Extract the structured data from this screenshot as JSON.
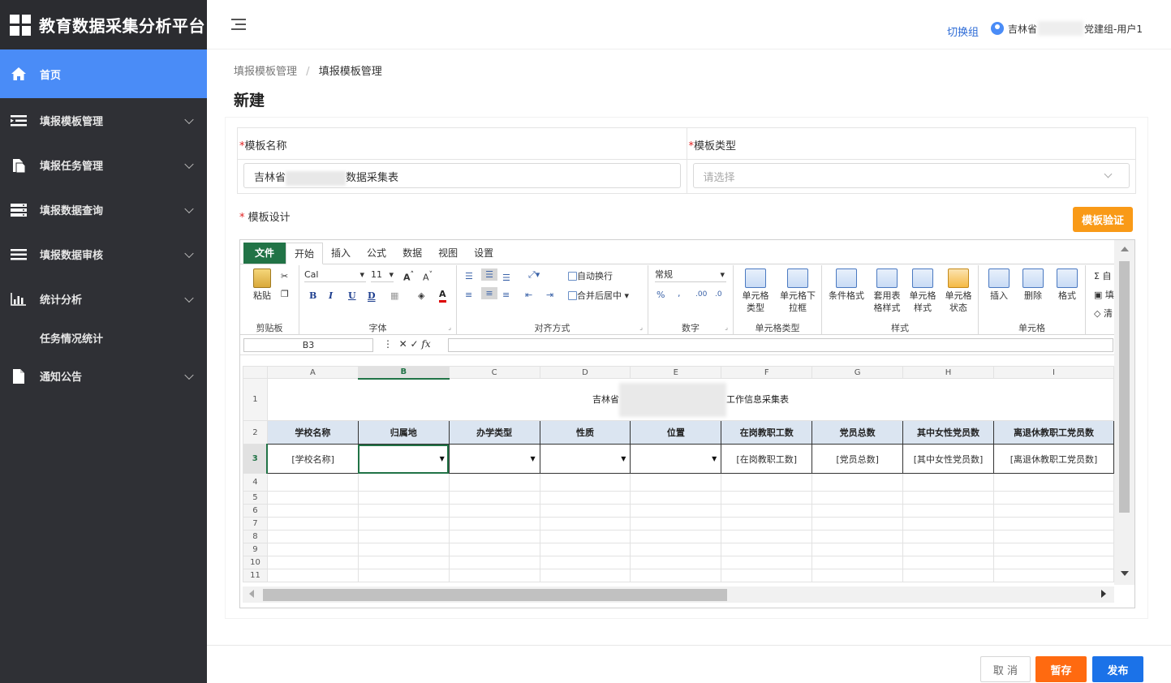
{
  "app": {
    "title": "教育数据采集分析平台"
  },
  "sidebar": {
    "items": [
      {
        "label": "首页",
        "icon": "home-icon",
        "active": true
      },
      {
        "label": "填报模板管理",
        "icon": "list-icon"
      },
      {
        "label": "填报任务管理",
        "icon": "document-icon"
      },
      {
        "label": "填报数据查询",
        "icon": "database-icon"
      },
      {
        "label": "填报数据审核",
        "icon": "stack-icon"
      },
      {
        "label": "统计分析",
        "icon": "bar-chart-icon"
      },
      {
        "label": "任务情况统计",
        "sub": true
      },
      {
        "label": "通知公告",
        "icon": "file-icon"
      }
    ]
  },
  "header": {
    "switch_group": "切换组",
    "user_prefix": "吉林省",
    "user_suffix": "党建组-用户1"
  },
  "breadcrumb": {
    "parent": "填报模板管理",
    "sep": "/",
    "current": "填报模板管理"
  },
  "page_title": "新建",
  "form": {
    "name_label": "模板名称",
    "name_value_prefix": "吉林省",
    "name_value_suffix": "数据采集表",
    "type_label": "模板类型",
    "type_placeholder": "请选择",
    "required_mark": "*",
    "design_label": "模板设计",
    "verify_button": "模板验证"
  },
  "spreadsheet": {
    "tabs": [
      "文件",
      "开始",
      "插入",
      "公式",
      "数据",
      "视图",
      "设置"
    ],
    "active_tab": "开始",
    "ribbon": {
      "clipboard": {
        "group": "剪贴板",
        "paste": "粘贴"
      },
      "font": {
        "group": "字体",
        "font_name": "Cal",
        "font_size": "11"
      },
      "align": {
        "group": "对齐方式",
        "wrap": "自动换行",
        "merge": "合并后居中"
      },
      "number": {
        "group": "数字",
        "format": "常规"
      },
      "celltype": {
        "group": "单元格类型",
        "type": "单元格类型",
        "dropdown": "单元格下拉框"
      },
      "style": {
        "group": "样式",
        "conditional": "条件格式",
        "table_style": "套用表格样式",
        "cell_style": "单元格样式",
        "cell_state": "单元格状态"
      },
      "cells": {
        "group": "单元格",
        "insert": "插入",
        "delete": "删除",
        "format": "格式"
      },
      "edit": {
        "autosum": "自",
        "fill": "填",
        "clear": "清"
      }
    },
    "name_box": "B3",
    "columns": [
      "A",
      "B",
      "C",
      "D",
      "E",
      "F",
      "G",
      "H",
      "I"
    ],
    "selected_column": "B",
    "rows": [
      "1",
      "2",
      "3",
      "4",
      "5",
      "6",
      "7",
      "8",
      "9",
      "10",
      "11"
    ],
    "selected_row": "3",
    "title_prefix": "吉林省",
    "title_suffix": "工作信息采集表",
    "headers": [
      "学校名称",
      "归属地",
      "办学类型",
      "性质",
      "位置",
      "在岗教职工数",
      "党员总数",
      "其中女性党员数",
      "离退休教职工党员数"
    ],
    "row3": [
      "[学校名称]",
      "",
      "",
      "",
      "",
      "[在岗教职工数]",
      "[党员总数]",
      "[其中女性党员数]",
      "[离退休教职工党员数]"
    ],
    "dropdown_marker": "▼"
  },
  "footer": {
    "cancel": "取 消",
    "save": "暂存",
    "publish": "发布"
  },
  "colors": {
    "sidebar_bg": "#2f3035",
    "active": "#4a8cf7",
    "excel_green": "#217346",
    "verify": "#f99a17",
    "save": "#ff6a10",
    "publish": "#1b72e8"
  }
}
